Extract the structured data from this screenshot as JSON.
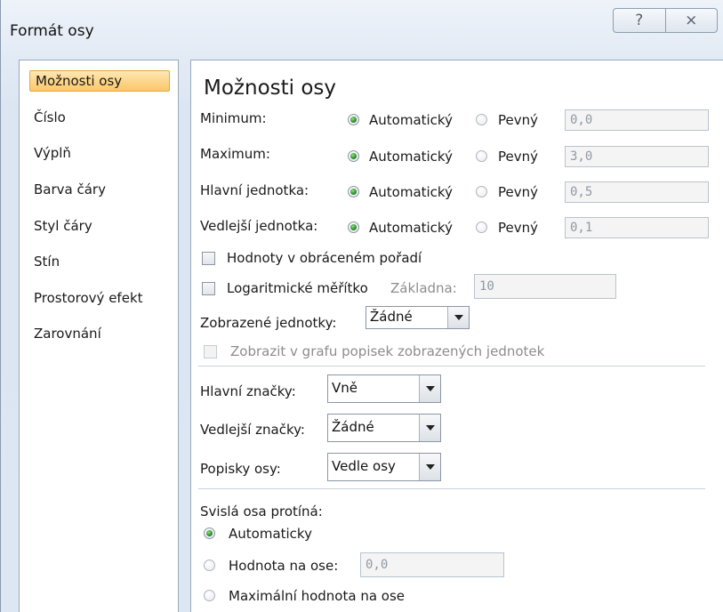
{
  "window": {
    "title": "Formát osy",
    "help_glyph": "?",
    "close_glyph": "⨯"
  },
  "nav": {
    "items": [
      "Možnosti osy",
      "Číslo",
      "Výplň",
      "Barva čáry",
      "Styl čáry",
      "Stín",
      "Prostorový efekt",
      "Zarovnání"
    ],
    "selected": "Možnosti osy"
  },
  "panel": {
    "heading": "Možnosti osy",
    "rows": [
      {
        "label": "Minimum:",
        "auto": "Automatický",
        "fixed": "Pevný",
        "value": "0,0"
      },
      {
        "label": "Maximum:",
        "auto": "Automatický",
        "fixed": "Pevný",
        "value": "3,0"
      },
      {
        "label": "Hlavní jednotka:",
        "auto": "Automatický",
        "fixed": "Pevný",
        "value": "0,5"
      },
      {
        "label": "Vedlejší jednotka:",
        "auto": "Automatický",
        "fixed": "Pevný",
        "value": "0,1"
      }
    ],
    "reverse_order": "Hodnoty v obráceném pořadí",
    "log_scale": "Logaritmické měřítko",
    "base_label": "Základna:",
    "base_value": "10",
    "display_units_label": "Zobrazené jednotky:",
    "display_units_value": "Žádné",
    "show_units_label": "Zobrazit v grafu popisek zobrazených jednotek",
    "major_tick_label": "Hlavní značky:",
    "major_tick_value": "Vně",
    "minor_tick_label": "Vedlejší značky:",
    "minor_tick_value": "Žádné",
    "axis_labels_label": "Popisky osy:",
    "axis_labels_value": "Vedle osy",
    "crosses_label": "Svislá osa protíná:",
    "cross_auto": "Automaticky",
    "cross_value_label": "Hodnota na ose:",
    "cross_value": "0,0",
    "cross_max": "Maximální hodnota na ose"
  }
}
